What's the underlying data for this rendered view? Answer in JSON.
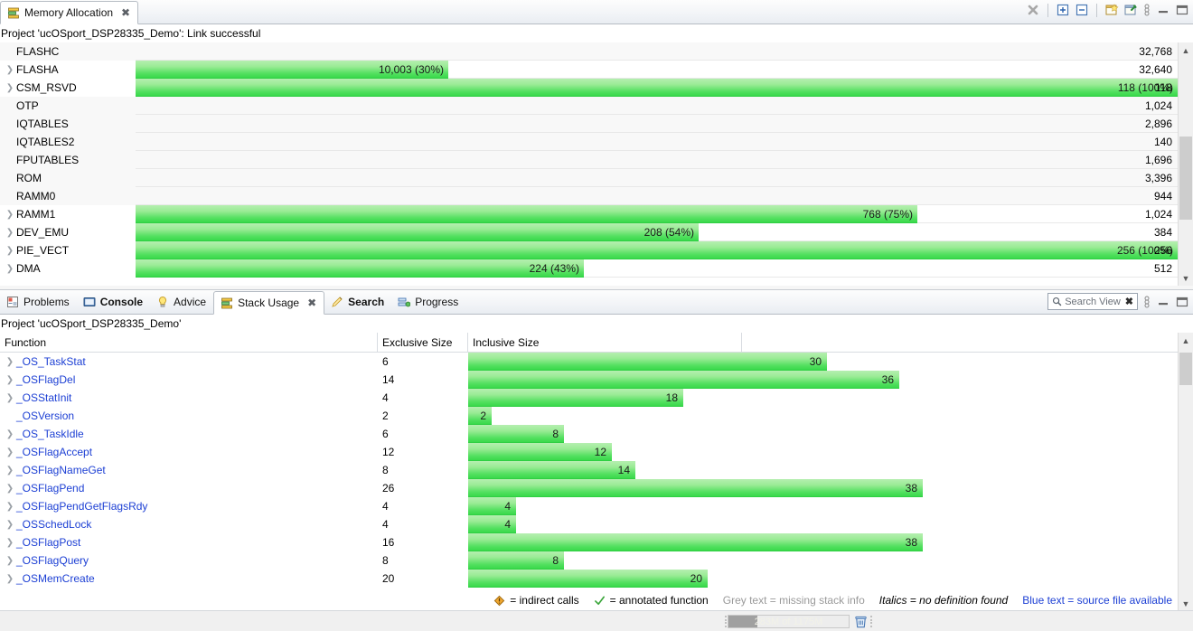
{
  "memory_view": {
    "tab_label": "Memory Allocation",
    "tab_close": "✖",
    "status_text": "Project 'ucOSport_DSP28335_Demo': Link successful",
    "toolbar": {
      "remove_all": "remove-all-icon",
      "expand_all": "expand-all-icon",
      "collapse_all": "collapse-all-icon",
      "new_view": "new-view-icon",
      "pin_view": "pin-view-icon",
      "view_menu": "view-menu-icon",
      "minimize": "minimize-icon",
      "maximize": "maximize-icon"
    },
    "rows": [
      {
        "name": "FLASHC",
        "expandable": false,
        "size": "32,768",
        "bar_pct": 0,
        "bar_label": ""
      },
      {
        "name": "FLASHA",
        "expandable": true,
        "size": "32,640",
        "bar_pct": 30,
        "bar_label": "10,003 (30%)"
      },
      {
        "name": "CSM_RSVD",
        "expandable": true,
        "size": "118",
        "bar_pct": 100,
        "bar_label": "118 (100%)"
      },
      {
        "name": "OTP",
        "expandable": false,
        "size": "1,024",
        "bar_pct": 0,
        "bar_label": ""
      },
      {
        "name": "IQTABLES",
        "expandable": false,
        "size": "2,896",
        "bar_pct": 0,
        "bar_label": ""
      },
      {
        "name": "IQTABLES2",
        "expandable": false,
        "size": "140",
        "bar_pct": 0,
        "bar_label": ""
      },
      {
        "name": "FPUTABLES",
        "expandable": false,
        "size": "1,696",
        "bar_pct": 0,
        "bar_label": ""
      },
      {
        "name": "ROM",
        "expandable": false,
        "size": "3,396",
        "bar_pct": 0,
        "bar_label": ""
      },
      {
        "name": "RAMM0",
        "expandable": false,
        "size": "944",
        "bar_pct": 0,
        "bar_label": ""
      },
      {
        "name": "RAMM1",
        "expandable": true,
        "size": "1,024",
        "bar_pct": 75,
        "bar_label": "768 (75%)"
      },
      {
        "name": "DEV_EMU",
        "expandable": true,
        "size": "384",
        "bar_pct": 54,
        "bar_label": "208 (54%)"
      },
      {
        "name": "PIE_VECT",
        "expandable": true,
        "size": "256",
        "bar_pct": 100,
        "bar_label": "256 (100%)"
      },
      {
        "name": "DMA",
        "expandable": true,
        "size": "512",
        "bar_pct": 43,
        "bar_label": "224 (43%)"
      }
    ]
  },
  "bottom_view": {
    "tabs": [
      {
        "label": "Problems",
        "icon": "problems-icon",
        "active": false,
        "bold": false,
        "closable": false
      },
      {
        "label": "Console",
        "icon": "console-icon",
        "active": false,
        "bold": true,
        "closable": false
      },
      {
        "label": "Advice",
        "icon": "advice-icon",
        "active": false,
        "bold": false,
        "closable": false
      },
      {
        "label": "Stack Usage",
        "icon": "stack-usage-icon",
        "active": true,
        "bold": false,
        "closable": true
      },
      {
        "label": "Search",
        "icon": "search-tab-icon",
        "active": false,
        "bold": true,
        "closable": false
      },
      {
        "label": "Progress",
        "icon": "progress-icon",
        "active": false,
        "bold": false,
        "closable": false
      }
    ],
    "tab_close": "✖",
    "search_view": {
      "label": "Search View",
      "close": "✖",
      "icon": "magnifier-icon"
    },
    "toolbar": {
      "view_menu": "view-menu-icon",
      "minimize": "minimize-icon",
      "maximize": "maximize-icon"
    },
    "status_text": "Project 'ucOSport_DSP28335_Demo'",
    "columns": [
      {
        "label": "Function"
      },
      {
        "label": "Exclusive Size"
      },
      {
        "label": "Inclusive Size"
      }
    ],
    "rows": [
      {
        "function": "_OS_TaskStat",
        "expandable": true,
        "exclusive": "6",
        "inclusive": 30,
        "inclusive_label": "30"
      },
      {
        "function": "_OSFlagDel",
        "expandable": true,
        "exclusive": "14",
        "inclusive": 36,
        "inclusive_label": "36"
      },
      {
        "function": "_OSStatInit",
        "expandable": true,
        "exclusive": "4",
        "inclusive": 18,
        "inclusive_label": "18"
      },
      {
        "function": "_OSVersion",
        "expandable": false,
        "exclusive": "2",
        "inclusive": 2,
        "inclusive_label": "2"
      },
      {
        "function": "_OS_TaskIdle",
        "expandable": true,
        "exclusive": "6",
        "inclusive": 8,
        "inclusive_label": "8"
      },
      {
        "function": "_OSFlagAccept",
        "expandable": true,
        "exclusive": "12",
        "inclusive": 12,
        "inclusive_label": "12"
      },
      {
        "function": "_OSFlagNameGet",
        "expandable": true,
        "exclusive": "8",
        "inclusive": 14,
        "inclusive_label": "14"
      },
      {
        "function": "_OSFlagPend",
        "expandable": true,
        "exclusive": "26",
        "inclusive": 38,
        "inclusive_label": "38"
      },
      {
        "function": "_OSFlagPendGetFlagsRdy",
        "expandable": true,
        "exclusive": "4",
        "inclusive": 4,
        "inclusive_label": "4"
      },
      {
        "function": "_OSSchedLock",
        "expandable": true,
        "exclusive": "4",
        "inclusive": 4,
        "inclusive_label": "4"
      },
      {
        "function": "_OSFlagPost",
        "expandable": true,
        "exclusive": "16",
        "inclusive": 38,
        "inclusive_label": "38"
      },
      {
        "function": "_OSFlagQuery",
        "expandable": true,
        "exclusive": "8",
        "inclusive": 8,
        "inclusive_label": "8"
      },
      {
        "function": "_OSMemCreate",
        "expandable": true,
        "exclusive": "20",
        "inclusive": 20,
        "inclusive_label": "20"
      }
    ],
    "inclusive_max": 38,
    "legend": [
      {
        "icon": "indirect-calls-icon",
        "text": "= indirect calls",
        "style": "normal"
      },
      {
        "icon": "annotated-check-icon",
        "text": "= annotated function",
        "style": "normal"
      },
      {
        "icon": "",
        "text": "Grey text = missing stack info",
        "style": "grey"
      },
      {
        "icon": "",
        "text": "Italics = no definition found",
        "style": "italic"
      },
      {
        "icon": "",
        "text": "Blue text = source file available",
        "style": "blue"
      }
    ]
  },
  "statusbar": {
    "heap_text": "283M of 1175M",
    "heap_fill_pct": 24,
    "trash_icon": "trash-icon"
  },
  "colors": {
    "bar_light": "#b5efb0",
    "bar_dark": "#3ad94b",
    "link_blue": "#1c3fd4",
    "grey_text": "#9a9a9a"
  }
}
